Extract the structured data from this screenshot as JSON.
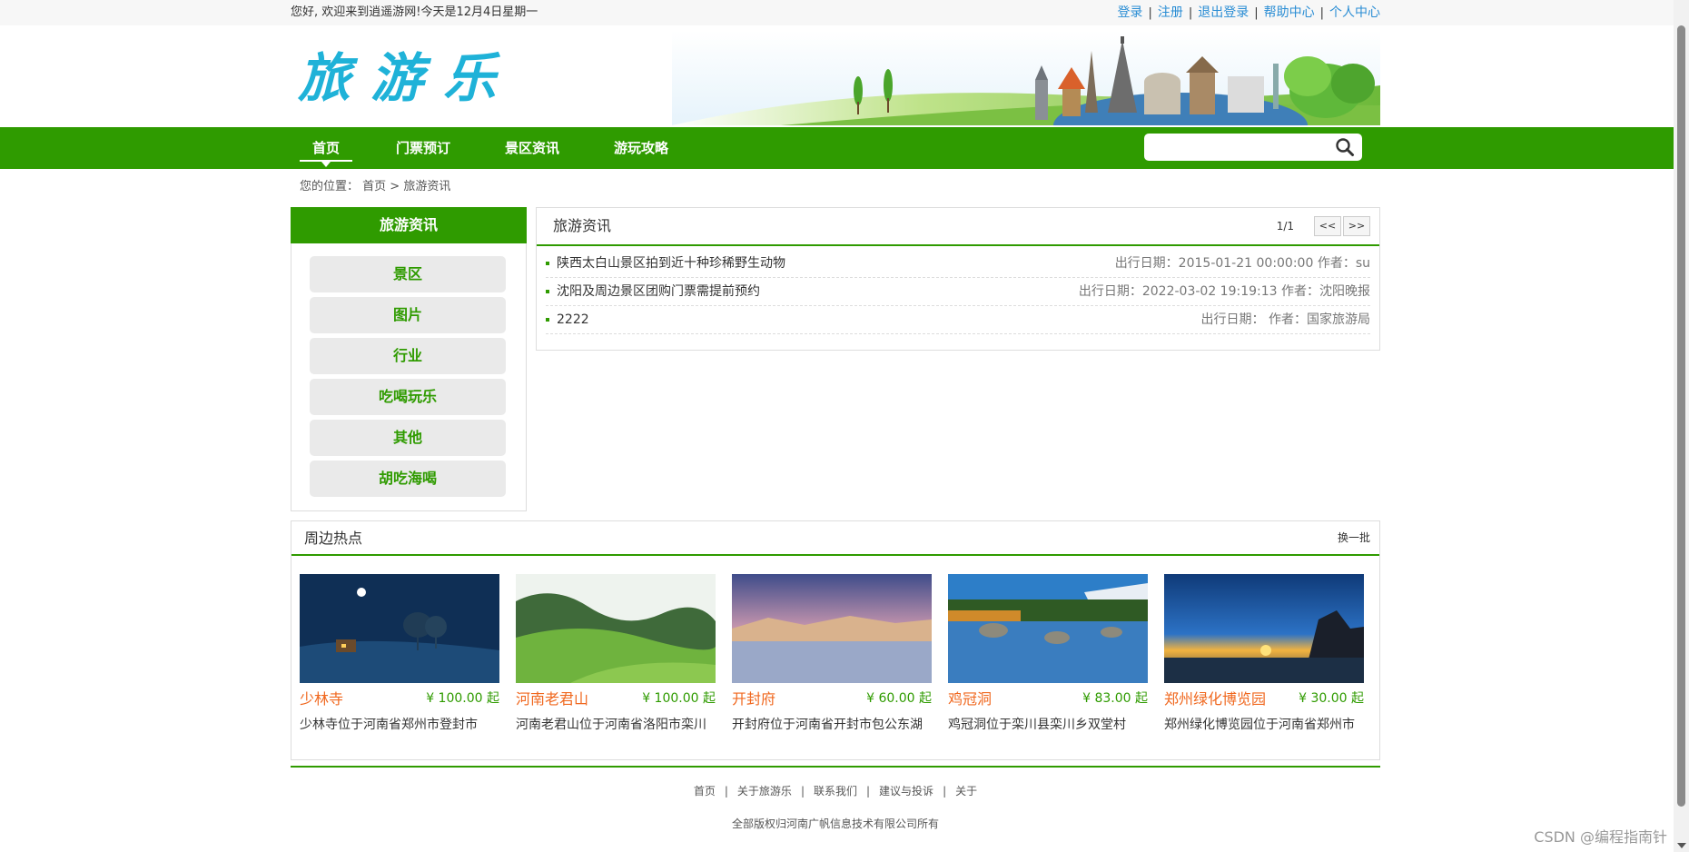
{
  "topbar": {
    "welcome": "您好, 欢迎来到逍遥游网!今天是12月4日星期一",
    "links": [
      "登录",
      "注册",
      "退出登录",
      "帮助中心",
      "个人中心"
    ]
  },
  "header": {
    "logo": "旅游乐"
  },
  "nav": {
    "items": [
      "首页",
      "门票预订",
      "景区资讯",
      "游玩攻略"
    ],
    "search_placeholder": ""
  },
  "breadcrumb": {
    "label": "您的位置：",
    "home": "首页 >",
    "current": "旅游资讯"
  },
  "sidebar": {
    "title": "旅游资讯",
    "items": [
      "景区",
      "图片",
      "行业",
      "吃喝玩乐",
      "其他",
      "胡吃海喝"
    ]
  },
  "news": {
    "title": "旅游资讯",
    "page": "1/1",
    "prev": "<<",
    "next": ">>",
    "rows": [
      {
        "title": "陕西太白山景区拍到近十种珍稀野生动物",
        "meta": "出行日期：2015-01-21 00:00:00 作者：su"
      },
      {
        "title": "沈阳及周边景区团购门票需提前预约",
        "meta": "出行日期：2022-03-02 19:19:13 作者：沈阳晚报"
      },
      {
        "title": "2222",
        "meta": "出行日期： 作者：国家旅游局"
      }
    ]
  },
  "hot": {
    "title": "周边热点",
    "more": "换一批",
    "cards": [
      {
        "name": "少林寺",
        "price": "¥ 100.00 起",
        "desc": "少林寺位于河南省郑州市登封市"
      },
      {
        "name": "河南老君山",
        "price": "¥ 100.00 起",
        "desc": "河南老君山位于河南省洛阳市栾川"
      },
      {
        "name": "开封府",
        "price": "¥ 60.00 起",
        "desc": "开封府位于河南省开封市包公东湖"
      },
      {
        "name": "鸡冠洞",
        "price": "¥ 83.00 起",
        "desc": "鸡冠洞位于栾川县栾川乡双堂村"
      },
      {
        "name": "郑州绿化博览园",
        "price": "¥ 30.00 起",
        "desc": "郑州绿化博览园位于河南省郑州市"
      }
    ]
  },
  "footer": {
    "links": [
      "首页",
      "关于旅游乐",
      "联系我们",
      "建议与投诉",
      "关于"
    ],
    "copyright": "全部版权归河南广帆信息技术有限公司所有"
  },
  "watermark": "CSDN @编程指南针",
  "colors": {
    "brand_green": "#2f9b00",
    "link_blue": "#2a8dd4",
    "accent_orange": "#f0681f",
    "logo_cyan": "#1fb2d8"
  }
}
